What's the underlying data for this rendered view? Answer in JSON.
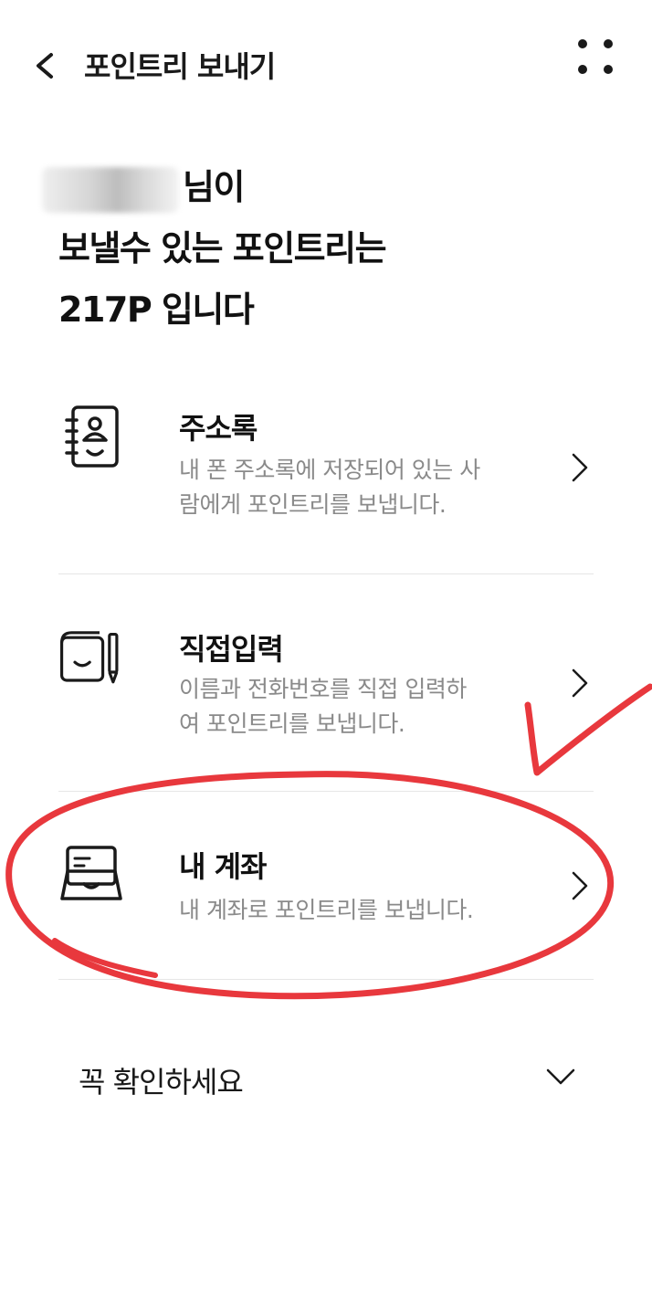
{
  "header": {
    "title": "포인트리 보내기"
  },
  "summary": {
    "name_suffix": "님이",
    "line2": "보낼수 있는 포인트리는",
    "points": "217P",
    "line3_suffix": " 입니다"
  },
  "menu": [
    {
      "icon": "address-book-icon",
      "title": "주소록",
      "desc_line1": "내 폰 주소록에 저장되어 있는 사",
      "desc_line2": "람에게 포인트리를 보냅니다."
    },
    {
      "icon": "notebook-pen-icon",
      "title": "직접입력",
      "desc_line1": "이름과 전화번호를 직접 입력하",
      "desc_line2": "여 포인트리를 보냅니다."
    },
    {
      "icon": "my-account-icon",
      "title": "내 계좌",
      "desc_line1": "내 계좌로 포인트리를 보냅니다."
    }
  ],
  "notice": {
    "label": "꼭 확인하세요"
  },
  "colors": {
    "annotation": "#e8383d",
    "desc_text": "#8a8a8a",
    "divider": "#e6e6e6"
  }
}
